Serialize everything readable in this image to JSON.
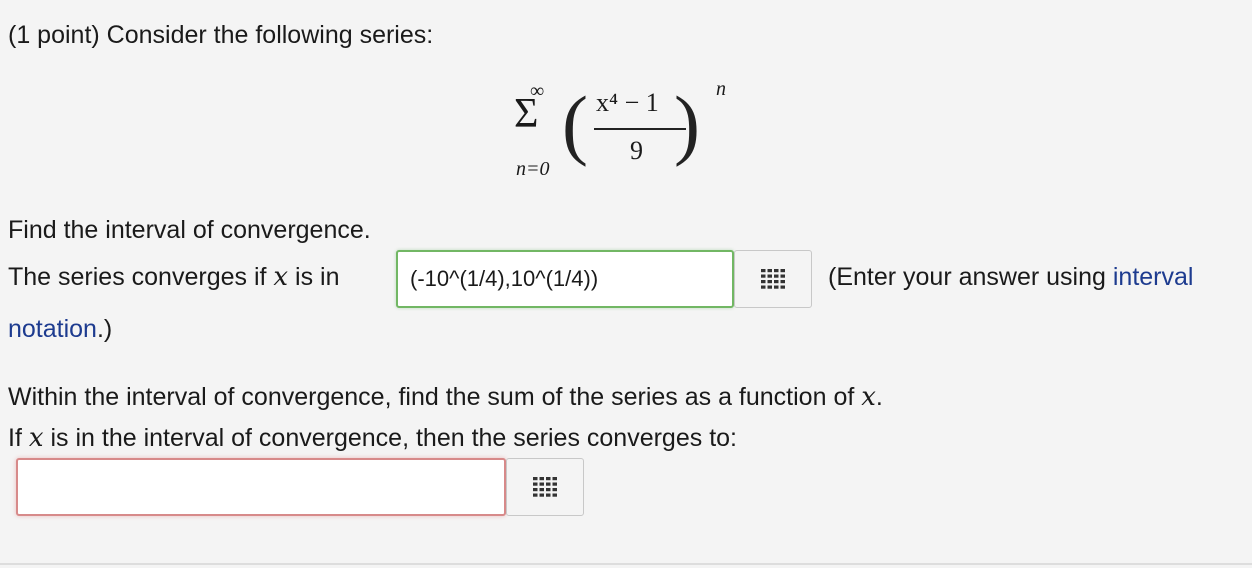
{
  "problem": {
    "intro": "(1 point) Consider the following series:"
  },
  "formula": {
    "sum_upper": "∞",
    "sum_symbol": "Σ",
    "sum_lower": "n=0",
    "left_paren": "(",
    "right_paren": ")",
    "numerator": "x⁴ − 1",
    "denominator": "9",
    "exponent": "n"
  },
  "part1": {
    "prompt": "Find the interval of convergence.",
    "lead_before_var": "The series converges if",
    "var": "x",
    "lead_after_var": "is in",
    "answer_value": "(-10^(1/4),10^(1/4))",
    "hint_before_link": "(Enter your answer using",
    "hint_link_part1": "interval",
    "hint_link_part2": "notation",
    "hint_after_link": ".)"
  },
  "part2": {
    "prompt_before_var": "Within the interval of convergence, find the sum of the series as a function of",
    "var": "x",
    "prompt_after_var": ".",
    "lead_before_var": "If",
    "lead_var": "x",
    "lead_after_var": "is in the interval of convergence, then the series converges to:",
    "answer_value": ""
  },
  "icons": {
    "palette": "equation-palette-grid-icon"
  },
  "colors": {
    "link": "#1d3b8f",
    "correct_border": "#72b764",
    "incorrect_border": "#d78a8a"
  }
}
